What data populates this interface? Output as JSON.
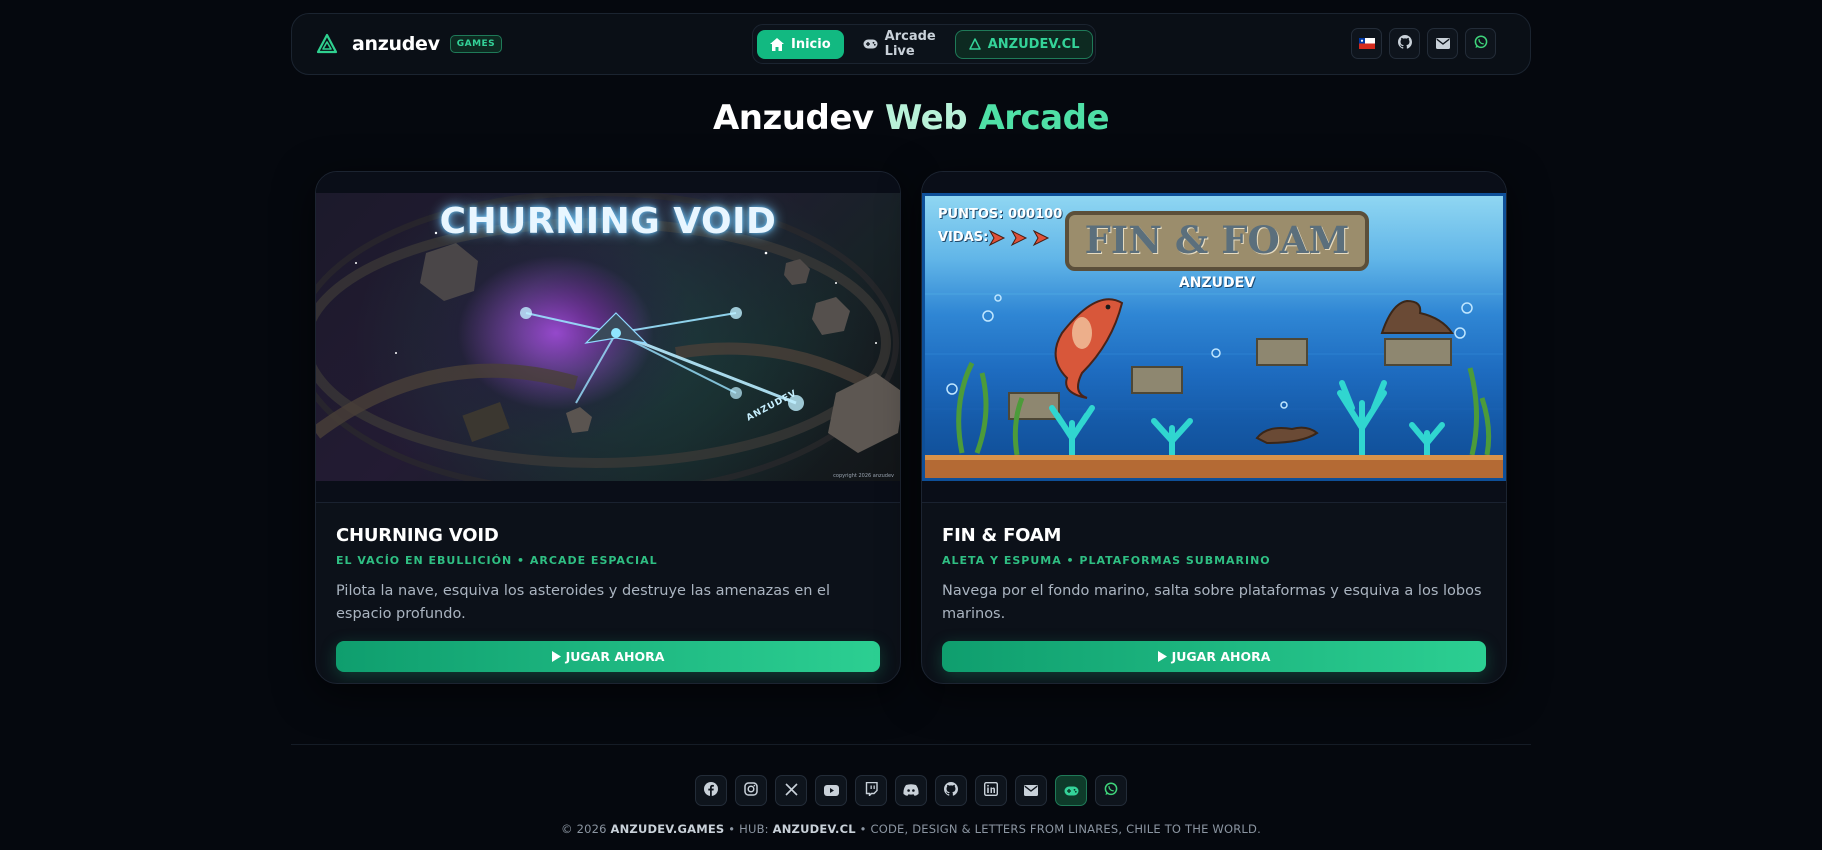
{
  "header": {
    "brand_name": "anzudev",
    "brand_badge": "GAMES",
    "nav": [
      {
        "label": "Inicio",
        "icon": "home-icon",
        "active": true
      },
      {
        "label": "Arcade Live",
        "icon": "gamepad-icon",
        "active": false
      },
      {
        "label": "ANZUDEV.CL",
        "icon": "triangle-logo-icon",
        "active": false
      }
    ],
    "right_icons": [
      "chile-flag-icon",
      "github-icon",
      "mail-icon",
      "whatsapp-icon"
    ]
  },
  "title": {
    "part1": "Anzudev",
    "part2": "Web",
    "part3": "Arcade"
  },
  "games": [
    {
      "title": "CHURNING VOID",
      "subtitle": "EL VACÍO EN EBULLICIÓN • ARCADE ESPACIAL",
      "description": "Pilota la nave, esquiva los asteroides y destruye las amenazas en el espacio profundo.",
      "button": "JUGAR AHORA",
      "image": {
        "logo_text": "CHURNING VOID",
        "ship_label": "ANZUDEV",
        "copyright": "copyright 2026 anzudev"
      }
    },
    {
      "title": "FIN & FOAM",
      "subtitle": "ALETA Y ESPUMA • PLATAFORMAS SUBMARINO",
      "description": "Navega por el fondo marino, salta sobre plataformas y esquiva a los lobos marinos.",
      "button": "JUGAR AHORA",
      "image": {
        "score_label": "PUNTOS: 000100",
        "lives_label": "VIDAS:",
        "logo_text": "FIN & FOAM",
        "studio": "ANZUDEV"
      }
    }
  ],
  "footer": {
    "social_icons": [
      "facebook-icon",
      "instagram-icon",
      "x-icon",
      "youtube-icon",
      "twitch-icon",
      "discord-icon",
      "github-icon",
      "linkedin-icon",
      "mail-icon",
      "gamepad-icon",
      "whatsapp-icon"
    ],
    "copyright_prefix": "© 2026",
    "copyright_brand": "ANZUDEV.GAMES",
    "copyright_hub_label": "• HUB:",
    "copyright_hub": "ANZUDEV.CL",
    "copyright_suffix": "• CODE, DESIGN & LETTERS FROM LINARES, CHILE TO THE WORLD."
  },
  "colors": {
    "accent": "#12b981",
    "accent_light": "#4fe0a6",
    "background": "#05080e",
    "card": "#0c1119"
  }
}
